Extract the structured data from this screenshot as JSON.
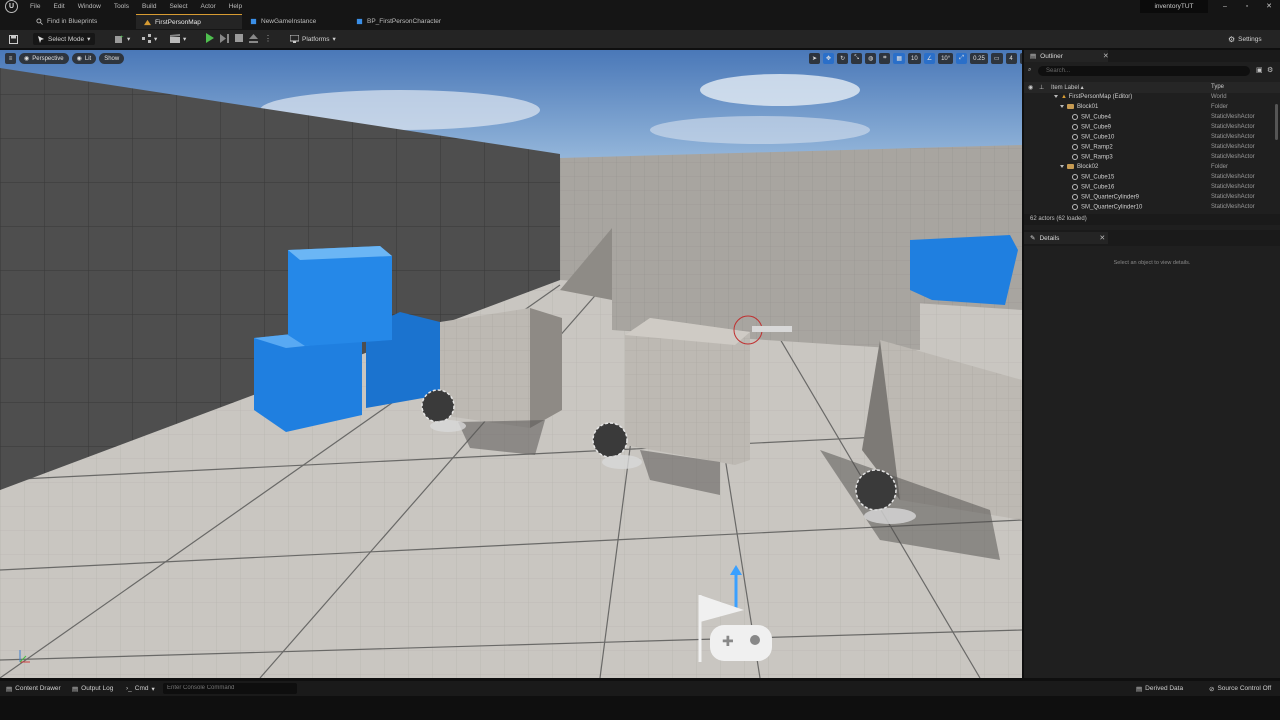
{
  "menu": [
    "File",
    "Edit",
    "Window",
    "Tools",
    "Build",
    "Select",
    "Actor",
    "Help"
  ],
  "project_name": "inventoryTUT",
  "window_controls": [
    "–",
    "▫",
    "✕"
  ],
  "tabs": [
    {
      "label": "Find in Blueprints",
      "icon": "search-icon"
    },
    {
      "label": "FirstPersonMap",
      "icon": "level-icon",
      "active": true
    },
    {
      "label": "NewGameInstance",
      "icon": "blueprint-icon"
    },
    {
      "label": "BP_FirstPersonCharacter",
      "icon": "blueprint-icon"
    }
  ],
  "toolbar": {
    "select_mode": "Select Mode",
    "platforms": "Platforms",
    "settings": "Settings"
  },
  "viewport": {
    "perspective": "Perspective",
    "lit": "Lit",
    "show": "Show",
    "grid_snap": "10",
    "angle_snap": "10°",
    "scale_snap": "0.25",
    "camera_speed": "4"
  },
  "outliner": {
    "title": "Outliner",
    "search_placeholder": "Search...",
    "col_label": "Item Label ▴",
    "col_type": "Type",
    "rows": [
      {
        "label": "FirstPersonMap (Editor)",
        "type": "World",
        "kind": "world"
      },
      {
        "label": "Block01",
        "type": "Folder",
        "kind": "folder"
      },
      {
        "label": "SM_Cube4",
        "type": "StaticMeshActor",
        "kind": "mesh"
      },
      {
        "label": "SM_Cube9",
        "type": "StaticMeshActor",
        "kind": "mesh"
      },
      {
        "label": "SM_Cube10",
        "type": "StaticMeshActor",
        "kind": "mesh"
      },
      {
        "label": "SM_Ramp2",
        "type": "StaticMeshActor",
        "kind": "mesh"
      },
      {
        "label": "SM_Ramp3",
        "type": "StaticMeshActor",
        "kind": "mesh"
      },
      {
        "label": "Block02",
        "type": "Folder",
        "kind": "folder"
      },
      {
        "label": "SM_Cube15",
        "type": "StaticMeshActor",
        "kind": "mesh"
      },
      {
        "label": "SM_Cube16",
        "type": "StaticMeshActor",
        "kind": "mesh"
      },
      {
        "label": "SM_QuarterCylinder9",
        "type": "StaticMeshActor",
        "kind": "mesh"
      },
      {
        "label": "SM_QuarterCylinder10",
        "type": "StaticMeshActor",
        "kind": "mesh"
      }
    ],
    "status": "62 actors (62 loaded)"
  },
  "details": {
    "title": "Details",
    "hint": "Select an object to view details."
  },
  "statusbar": {
    "content_drawer": "Content Drawer",
    "output_log": "Output Log",
    "cmd": "Cmd",
    "console_placeholder": "Enter Console Command",
    "derived_data": "Derived Data",
    "source_control": "Source Control Off"
  },
  "colors": {
    "accent_blue": "#1f7fe0",
    "play_green": "#4fbf4f",
    "tab_highlight": "#d79b32"
  }
}
